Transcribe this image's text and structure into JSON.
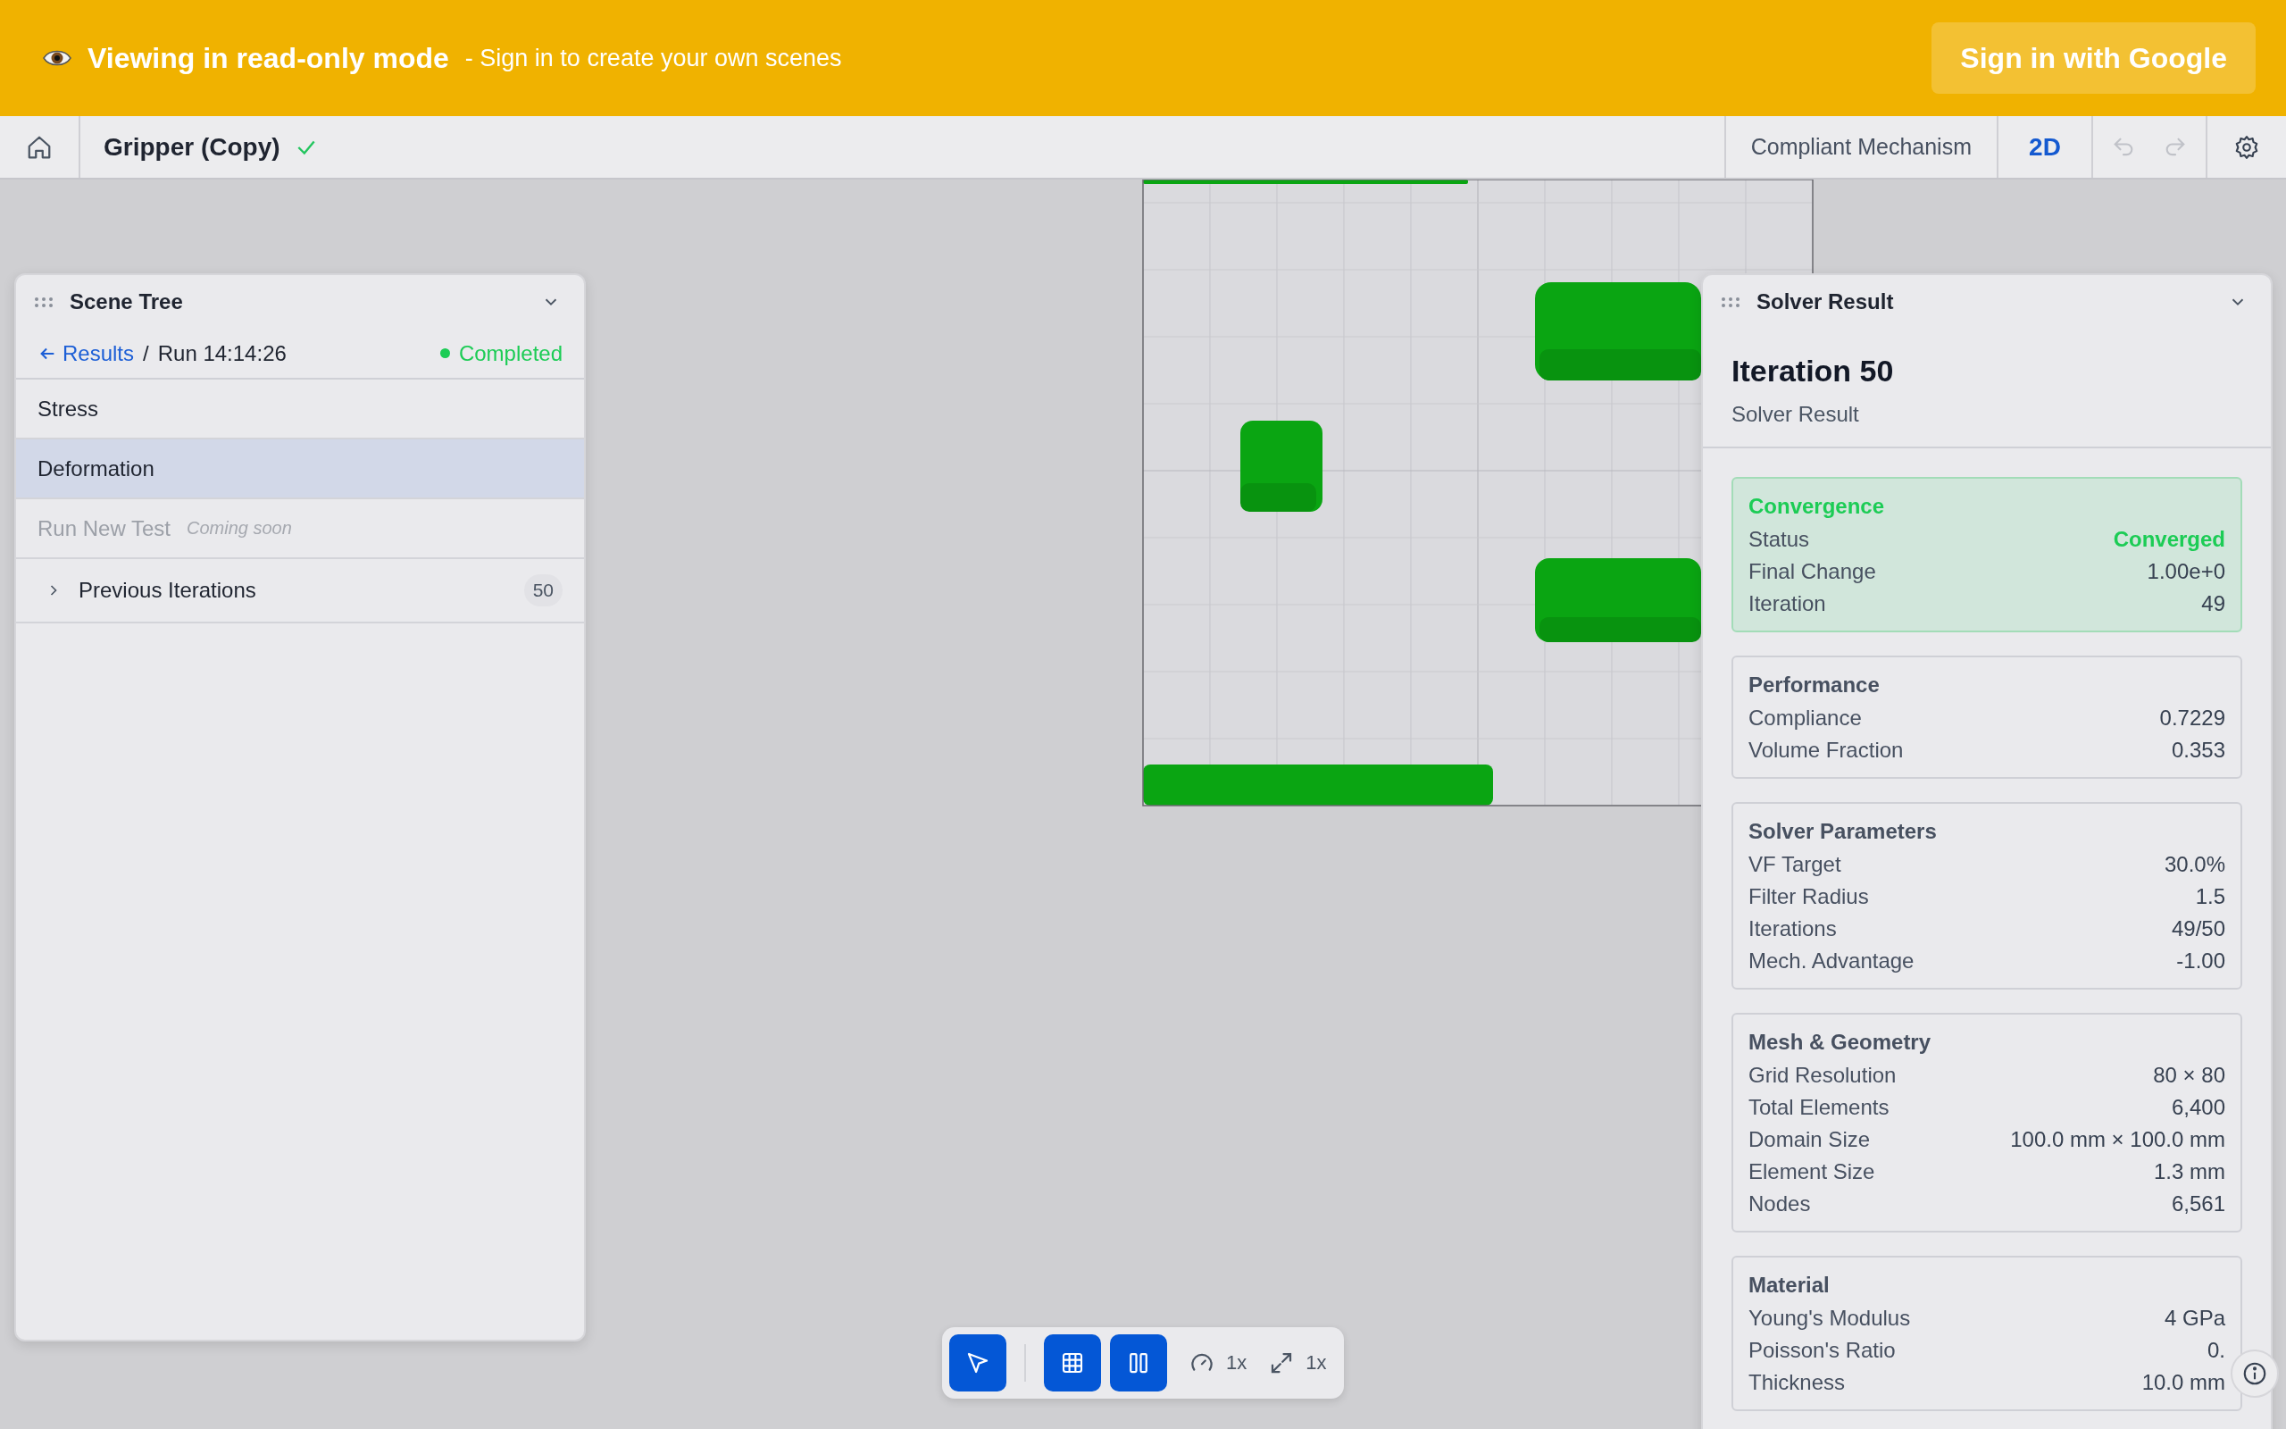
{
  "banner": {
    "title": "Viewing in read-only mode",
    "subtitle": "- Sign in to create your own scenes",
    "button": "Sign in with Google"
  },
  "header": {
    "project": "Gripper (Copy)",
    "saved": true,
    "mode": "Compliant Mechanism",
    "view": "2D",
    "undo_disabled": true,
    "redo_disabled": true
  },
  "scene_tree": {
    "title": "Scene Tree",
    "breadcrumb": {
      "link": "Results",
      "separator": "/",
      "current": "Run 14:14:26"
    },
    "status": "Completed",
    "items": [
      {
        "kind": "item",
        "label": "Stress",
        "selected": false,
        "disabled": false
      },
      {
        "kind": "item",
        "label": "Deformation",
        "selected": true,
        "disabled": false
      },
      {
        "kind": "item",
        "label": "Run New Test",
        "note": "Coming soon",
        "selected": false,
        "disabled": true
      },
      {
        "kind": "group",
        "label": "Previous Iterations",
        "count": "50",
        "selected": false,
        "disabled": false,
        "expanded": false
      }
    ]
  },
  "solver_result": {
    "title": "Solver Result",
    "heading": "Iteration 50",
    "subheading": "Solver Result",
    "sections": [
      {
        "title": "Convergence",
        "highlight": true,
        "rows": [
          {
            "label": "Status",
            "value": "Converged",
            "accent": true
          },
          {
            "label": "Final Change",
            "value": "1.00e+0",
            "accent": false
          },
          {
            "label": "Iteration",
            "value": "49",
            "accent": false
          }
        ]
      },
      {
        "title": "Performance",
        "highlight": false,
        "rows": [
          {
            "label": "Compliance",
            "value": "0.7229",
            "accent": false
          },
          {
            "label": "Volume Fraction",
            "value": "0.353",
            "accent": false
          }
        ]
      },
      {
        "title": "Solver Parameters",
        "highlight": false,
        "rows": [
          {
            "label": "VF Target",
            "value": "30.0%",
            "accent": false
          },
          {
            "label": "Filter Radius",
            "value": "1.5",
            "accent": false
          },
          {
            "label": "Iterations",
            "value": "49/50",
            "accent": false
          },
          {
            "label": "Mech. Advantage",
            "value": "-1.00",
            "accent": false
          }
        ]
      },
      {
        "title": "Mesh & Geometry",
        "highlight": false,
        "rows": [
          {
            "label": "Grid Resolution",
            "value": "80 × 80",
            "accent": false
          },
          {
            "label": "Total Elements",
            "value": "6,400",
            "accent": false
          },
          {
            "label": "Domain Size",
            "value": "100.0 mm × 100.0 mm",
            "accent": false
          },
          {
            "label": "Element Size",
            "value": "1.3 mm",
            "accent": false
          },
          {
            "label": "Nodes",
            "value": "6,561",
            "accent": false
          }
        ]
      },
      {
        "title": "Material",
        "highlight": false,
        "rows": [
          {
            "label": "Young's Modulus",
            "value": "4 GPa",
            "accent": false
          },
          {
            "label": "Poisson's Ratio",
            "value": "0.",
            "accent": false
          },
          {
            "label": "Thickness",
            "value": "10.0 mm",
            "accent": false
          }
        ]
      }
    ]
  },
  "toolbar": {
    "tools": [
      {
        "kind": "select",
        "selected": true
      },
      {
        "kind": "grid",
        "selected": true
      },
      {
        "kind": "columns",
        "selected": true
      }
    ],
    "speed": "1x",
    "scale": "1x"
  }
}
